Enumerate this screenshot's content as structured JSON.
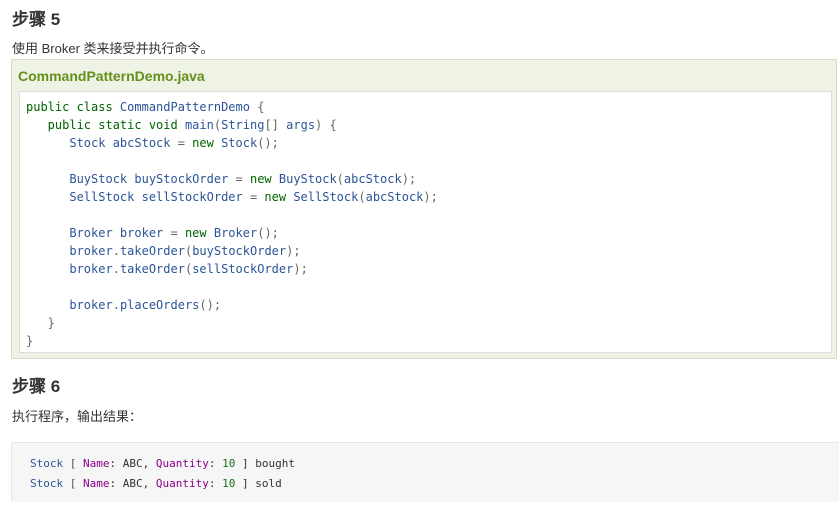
{
  "step5": {
    "heading_prefix": "步骤",
    "heading_number": "5",
    "description": "使用 Broker 类来接受并执行命令。"
  },
  "example": {
    "title": "CommandPatternDemo.java",
    "code_lines": [
      [
        {
          "t": "public class ",
          "c": "kw"
        },
        {
          "t": "CommandPatternDemo",
          "c": "ty"
        },
        {
          "t": " {",
          "c": "pn"
        }
      ],
      [
        {
          "t": "   public static void ",
          "c": "kw"
        },
        {
          "t": "main",
          "c": "ty"
        },
        {
          "t": "(",
          "c": "pn"
        },
        {
          "t": "String",
          "c": "ty"
        },
        {
          "t": "[] ",
          "c": "pn"
        },
        {
          "t": "args",
          "c": "ty"
        },
        {
          "t": ") {",
          "c": "pn"
        }
      ],
      [
        {
          "t": "      Stock abcStock ",
          "c": "ty"
        },
        {
          "t": "= ",
          "c": "pn"
        },
        {
          "t": "new ",
          "c": "kw"
        },
        {
          "t": "Stock",
          "c": "ty"
        },
        {
          "t": "();",
          "c": "pn"
        }
      ],
      [],
      [
        {
          "t": "      BuyStock buyStockOrder ",
          "c": "ty"
        },
        {
          "t": "= ",
          "c": "pn"
        },
        {
          "t": "new ",
          "c": "kw"
        },
        {
          "t": "BuyStock",
          "c": "ty"
        },
        {
          "t": "(",
          "c": "pn"
        },
        {
          "t": "abcStock",
          "c": "ty"
        },
        {
          "t": ");",
          "c": "pn"
        }
      ],
      [
        {
          "t": "      SellStock sellStockOrder ",
          "c": "ty"
        },
        {
          "t": "= ",
          "c": "pn"
        },
        {
          "t": "new ",
          "c": "kw"
        },
        {
          "t": "SellStock",
          "c": "ty"
        },
        {
          "t": "(",
          "c": "pn"
        },
        {
          "t": "abcStock",
          "c": "ty"
        },
        {
          "t": ");",
          "c": "pn"
        }
      ],
      [],
      [
        {
          "t": "      Broker broker ",
          "c": "ty"
        },
        {
          "t": "= ",
          "c": "pn"
        },
        {
          "t": "new ",
          "c": "kw"
        },
        {
          "t": "Broker",
          "c": "ty"
        },
        {
          "t": "();",
          "c": "pn"
        }
      ],
      [
        {
          "t": "      broker",
          "c": "ty"
        },
        {
          "t": ".",
          "c": "pn"
        },
        {
          "t": "takeOrder",
          "c": "ty"
        },
        {
          "t": "(",
          "c": "pn"
        },
        {
          "t": "buyStockOrder",
          "c": "ty"
        },
        {
          "t": ");",
          "c": "pn"
        }
      ],
      [
        {
          "t": "      broker",
          "c": "ty"
        },
        {
          "t": ".",
          "c": "pn"
        },
        {
          "t": "takeOrder",
          "c": "ty"
        },
        {
          "t": "(",
          "c": "pn"
        },
        {
          "t": "sellStockOrder",
          "c": "ty"
        },
        {
          "t": ");",
          "c": "pn"
        }
      ],
      [],
      [
        {
          "t": "      broker",
          "c": "ty"
        },
        {
          "t": ".",
          "c": "pn"
        },
        {
          "t": "placeOrders",
          "c": "ty"
        },
        {
          "t": "();",
          "c": "pn"
        }
      ],
      [
        {
          "t": "   }",
          "c": "pn"
        }
      ],
      [
        {
          "t": "}",
          "c": "pn"
        }
      ]
    ]
  },
  "step6": {
    "heading_prefix": "步骤",
    "heading_number": "6",
    "description": "执行程序，输出结果："
  },
  "output": {
    "lines": [
      [
        {
          "t": "Stock ",
          "c": "o-ty"
        },
        {
          "t": "[ ",
          "c": "o-pn"
        },
        {
          "t": "Name",
          "c": "o-kw"
        },
        {
          "t": ": ABC, ",
          "c": "o-tx"
        },
        {
          "t": "Quantity",
          "c": "o-kw"
        },
        {
          "t": ": ",
          "c": "o-tx"
        },
        {
          "t": "10",
          "c": "o-num"
        },
        {
          "t": " ] bought",
          "c": "o-tx"
        }
      ],
      [
        {
          "t": "Stock ",
          "c": "o-ty"
        },
        {
          "t": "[ ",
          "c": "o-pn"
        },
        {
          "t": "Name",
          "c": "o-kw"
        },
        {
          "t": ": ABC, ",
          "c": "o-tx"
        },
        {
          "t": "Quantity",
          "c": "o-kw"
        },
        {
          "t": ": ",
          "c": "o-tx"
        },
        {
          "t": "10",
          "c": "o-num"
        },
        {
          "t": " ] sold",
          "c": "o-tx"
        }
      ]
    ]
  }
}
